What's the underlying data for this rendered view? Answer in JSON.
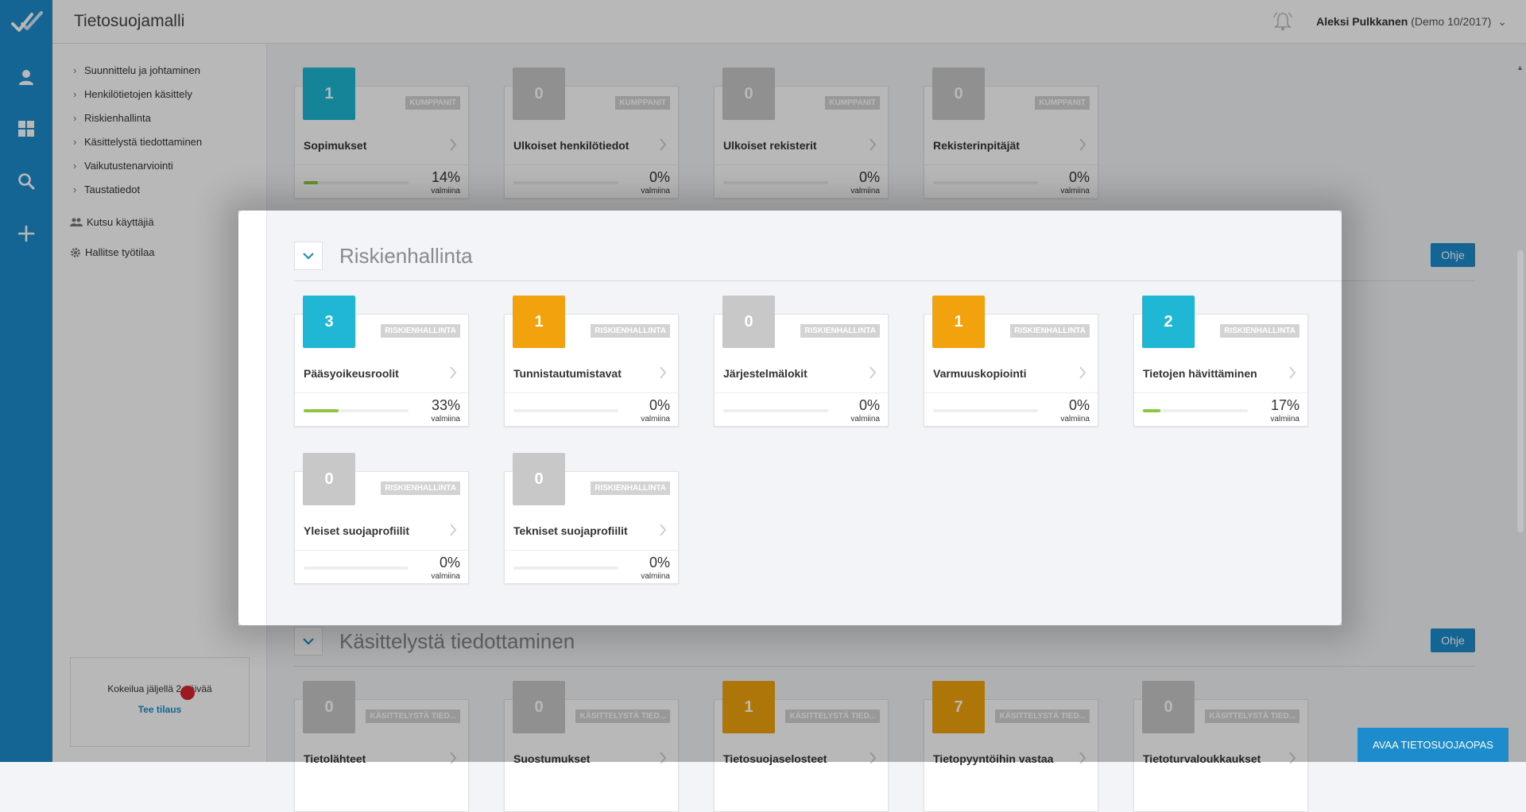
{
  "header": {
    "app_title": "Tietosuojamalli",
    "user_name": "Aleksi Pulkkanen",
    "user_org": "(Demo 10/2017)"
  },
  "sidebar": {
    "nav": [
      {
        "label": "Suunnittelu ja johtaminen"
      },
      {
        "label": "Henkilötietojen käsittely"
      },
      {
        "label": "Riskienhallinta"
      },
      {
        "label": "Käsittelystä tiedottaminen"
      },
      {
        "label": "Vaikutustenarviointi"
      },
      {
        "label": "Taustatiedot"
      }
    ],
    "invite_label": "Kutsu käyttäjiä",
    "manage_label": "Hallitse työtilaa",
    "trial_text": "Kokeilua jäljellä 2 päivää",
    "trial_link": "Tee tilaus"
  },
  "sections": {
    "kumppanit": {
      "cards": [
        {
          "count": "1",
          "color": "teal",
          "tag": "KUMPPANIT",
          "name": "Sopimukset",
          "pct": "14%",
          "progress": 14,
          "ready": "valmiina"
        },
        {
          "count": "0",
          "color": "grey",
          "tag": "KUMPPANIT",
          "name": "Ulkoiset henkilötiedot",
          "pct": "0%",
          "progress": 0,
          "ready": "valmiina"
        },
        {
          "count": "0",
          "color": "grey",
          "tag": "KUMPPANIT",
          "name": "Ulkoiset rekisterit",
          "pct": "0%",
          "progress": 0,
          "ready": "valmiina"
        },
        {
          "count": "0",
          "color": "grey",
          "tag": "KUMPPANIT",
          "name": "Rekisterinpitäjät",
          "pct": "0%",
          "progress": 0,
          "ready": "valmiina"
        }
      ]
    },
    "riskienhallinta": {
      "title": "Riskienhallinta",
      "help": "Ohje",
      "cards": [
        {
          "count": "3",
          "color": "teal",
          "tag": "RISKIENHALLINTA",
          "name": "Pääsyoikeusroolit",
          "pct": "33%",
          "progress": 33,
          "ready": "valmiina"
        },
        {
          "count": "1",
          "color": "orange",
          "tag": "RISKIENHALLINTA",
          "name": "Tunnistautumistavat",
          "pct": "0%",
          "progress": 0,
          "ready": "valmiina"
        },
        {
          "count": "0",
          "color": "grey",
          "tag": "RISKIENHALLINTA",
          "name": "Järjestelmälokit",
          "pct": "0%",
          "progress": 0,
          "ready": "valmiina"
        },
        {
          "count": "1",
          "color": "orange",
          "tag": "RISKIENHALLINTA",
          "name": "Varmuuskopiointi",
          "pct": "0%",
          "progress": 0,
          "ready": "valmiina"
        },
        {
          "count": "2",
          "color": "teal",
          "tag": "RISKIENHALLINTA",
          "name": "Tietojen hävittäminen",
          "pct": "17%",
          "progress": 17,
          "ready": "valmiina"
        },
        {
          "count": "0",
          "color": "grey",
          "tag": "RISKIENHALLINTA",
          "name": "Yleiset suojaprofiilit",
          "pct": "0%",
          "progress": 0,
          "ready": "valmiina"
        },
        {
          "count": "0",
          "color": "grey",
          "tag": "RISKIENHALLINTA",
          "name": "Tekniset suojaprofiilit",
          "pct": "0%",
          "progress": 0,
          "ready": "valmiina"
        }
      ]
    },
    "kasittely": {
      "title": "Käsittelystä tiedottaminen",
      "help": "Ohje",
      "cards": [
        {
          "count": "0",
          "color": "grey",
          "tag": "KÄSITTELYSTÄ TIED...",
          "name": "Tietolähteet"
        },
        {
          "count": "0",
          "color": "grey",
          "tag": "KÄSITTELYSTÄ TIED...",
          "name": "Suostumukset"
        },
        {
          "count": "1",
          "color": "orange",
          "tag": "KÄSITTELYSTÄ TIED...",
          "name": "Tietosuojaselosteet"
        },
        {
          "count": "7",
          "color": "orange",
          "tag": "KÄSITTELYSTÄ TIED...",
          "name": "Tietopyyntöihin vastaa"
        },
        {
          "count": "0",
          "color": "grey",
          "tag": "KÄSITTELYSTÄ TIED...",
          "name": "Tietoturvaloukkaukset"
        }
      ]
    }
  },
  "guide_button": "AVAA TIETOSUOJAOPAS",
  "colors": {
    "brand": "#1c8ccc",
    "teal": "#1fb7d3",
    "orange": "#f2a20c",
    "grey": "#c8c8c8",
    "progress": "#8cc63f"
  }
}
